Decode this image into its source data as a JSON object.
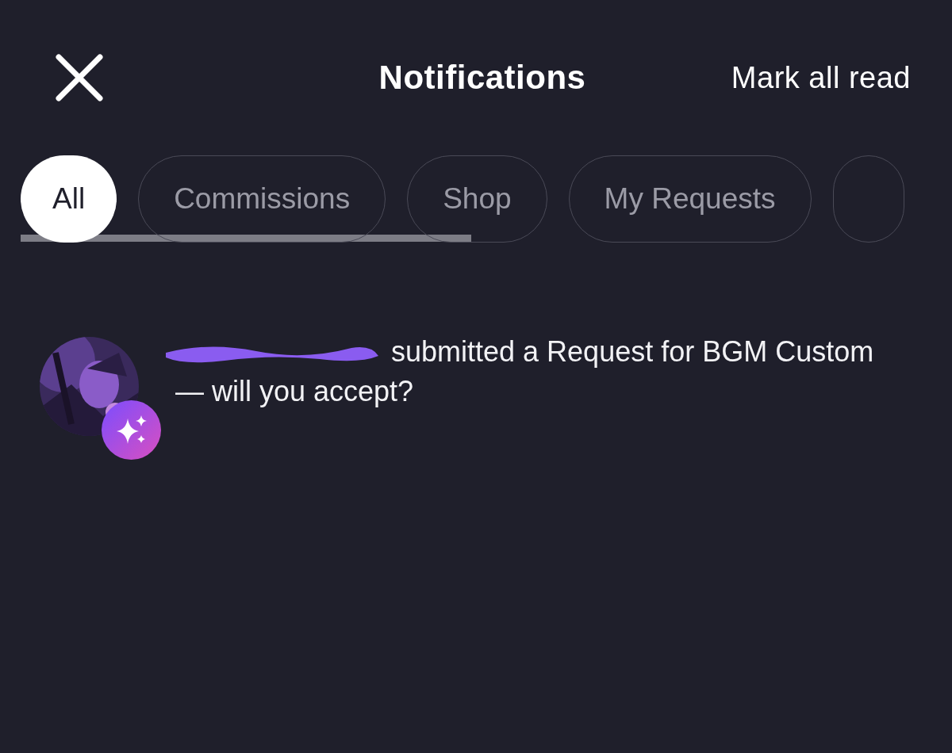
{
  "header": {
    "title": "Notifications",
    "action": "Mark all read"
  },
  "tabs": [
    {
      "label": "All",
      "selected": true
    },
    {
      "label": "Commissions",
      "selected": false
    },
    {
      "label": "Shop",
      "selected": false
    },
    {
      "label": "My Requests",
      "selected": false
    },
    {
      "selected": false
    }
  ],
  "notifications": [
    {
      "text": "submitted a Request for BGM Custom — will you accept?",
      "redacted_name": true,
      "kind": "request"
    }
  ]
}
